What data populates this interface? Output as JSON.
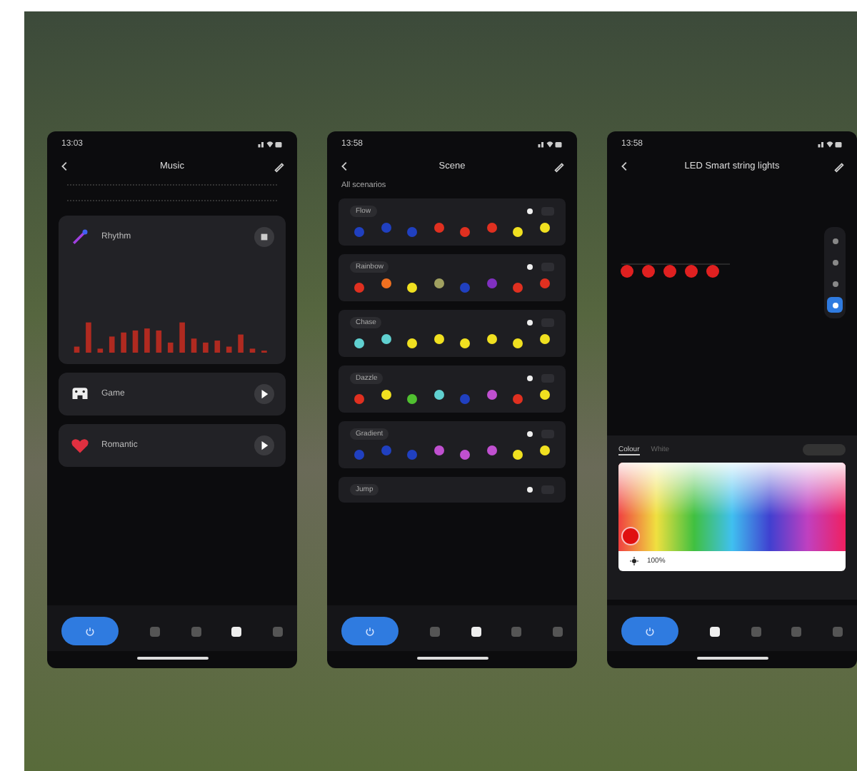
{
  "screens": [
    {
      "kind": "music",
      "status_time": "13:03",
      "title": "Music",
      "cards": [
        {
          "kind": "rhythm",
          "label": "Rhythm"
        },
        {
          "kind": "game",
          "label": "Game"
        },
        {
          "kind": "romantic",
          "label": "Romantic"
        }
      ],
      "nav": [
        {
          "selected": false
        },
        {
          "selected": false
        },
        {
          "selected": true
        },
        {
          "selected": false
        }
      ]
    },
    {
      "kind": "scene",
      "status_time": "13:58",
      "title": "Scene",
      "subtitle": "All scenarios",
      "scenes": [
        {
          "name": "Flow",
          "dots": [
            {
              "color": "#2040c0"
            },
            {
              "color": "#2040c0"
            },
            {
              "color": "#2040c0"
            },
            {
              "color": "#e03020"
            },
            {
              "color": "#e03020"
            },
            {
              "color": "#e03020"
            },
            {
              "color": "#f0e020"
            },
            {
              "color": "#f0e020"
            }
          ]
        },
        {
          "name": "Rainbow",
          "dots": [
            {
              "color": "#e03020"
            },
            {
              "color": "#f07020"
            },
            {
              "color": "#f0e020"
            },
            {
              "color": "#a0a060"
            },
            {
              "color": "#2040c0"
            },
            {
              "color": "#8030c0"
            },
            {
              "color": "#e03020"
            },
            {
              "color": "#e03020"
            }
          ]
        },
        {
          "name": "Chase",
          "dots": [
            {
              "color": "#60d0d0"
            },
            {
              "color": "#60d0d0"
            },
            {
              "color": "#f0e020"
            },
            {
              "color": "#f0e020"
            },
            {
              "color": "#f0e020"
            },
            {
              "color": "#f0e020"
            },
            {
              "color": "#f0e020"
            },
            {
              "color": "#f0e020"
            }
          ]
        },
        {
          "name": "Dazzle",
          "dots": [
            {
              "color": "#e03020"
            },
            {
              "color": "#f0e020"
            },
            {
              "color": "#50c030"
            },
            {
              "color": "#60d0d0"
            },
            {
              "color": "#2040c0"
            },
            {
              "color": "#c050d0"
            },
            {
              "color": "#e03020"
            },
            {
              "color": "#f0e020"
            }
          ]
        },
        {
          "name": "Gradient",
          "dots": [
            {
              "color": "#2040c0"
            },
            {
              "color": "#2040c0"
            },
            {
              "color": "#2040c0"
            },
            {
              "color": "#c050d0"
            },
            {
              "color": "#c050d0"
            },
            {
              "color": "#c050d0"
            },
            {
              "color": "#f0e020"
            },
            {
              "color": "#f0e020"
            }
          ]
        },
        {
          "name": "Jump"
        }
      ],
      "nav": [
        {
          "selected": false
        },
        {
          "selected": true
        },
        {
          "selected": false
        },
        {
          "selected": false
        }
      ]
    },
    {
      "kind": "lights",
      "status_time": "13:58",
      "title": "LED Smart string lights",
      "tools": [
        {
          "selected": false
        },
        {
          "selected": false
        },
        {
          "selected": false
        },
        {
          "selected": true
        }
      ],
      "tabs": [
        {
          "label": "Colour",
          "selected": true
        },
        {
          "label": "White",
          "selected": false
        }
      ],
      "brightness": "100%",
      "nav": [
        {
          "selected": true
        },
        {
          "selected": false
        },
        {
          "selected": false
        },
        {
          "selected": false
        }
      ]
    }
  ]
}
